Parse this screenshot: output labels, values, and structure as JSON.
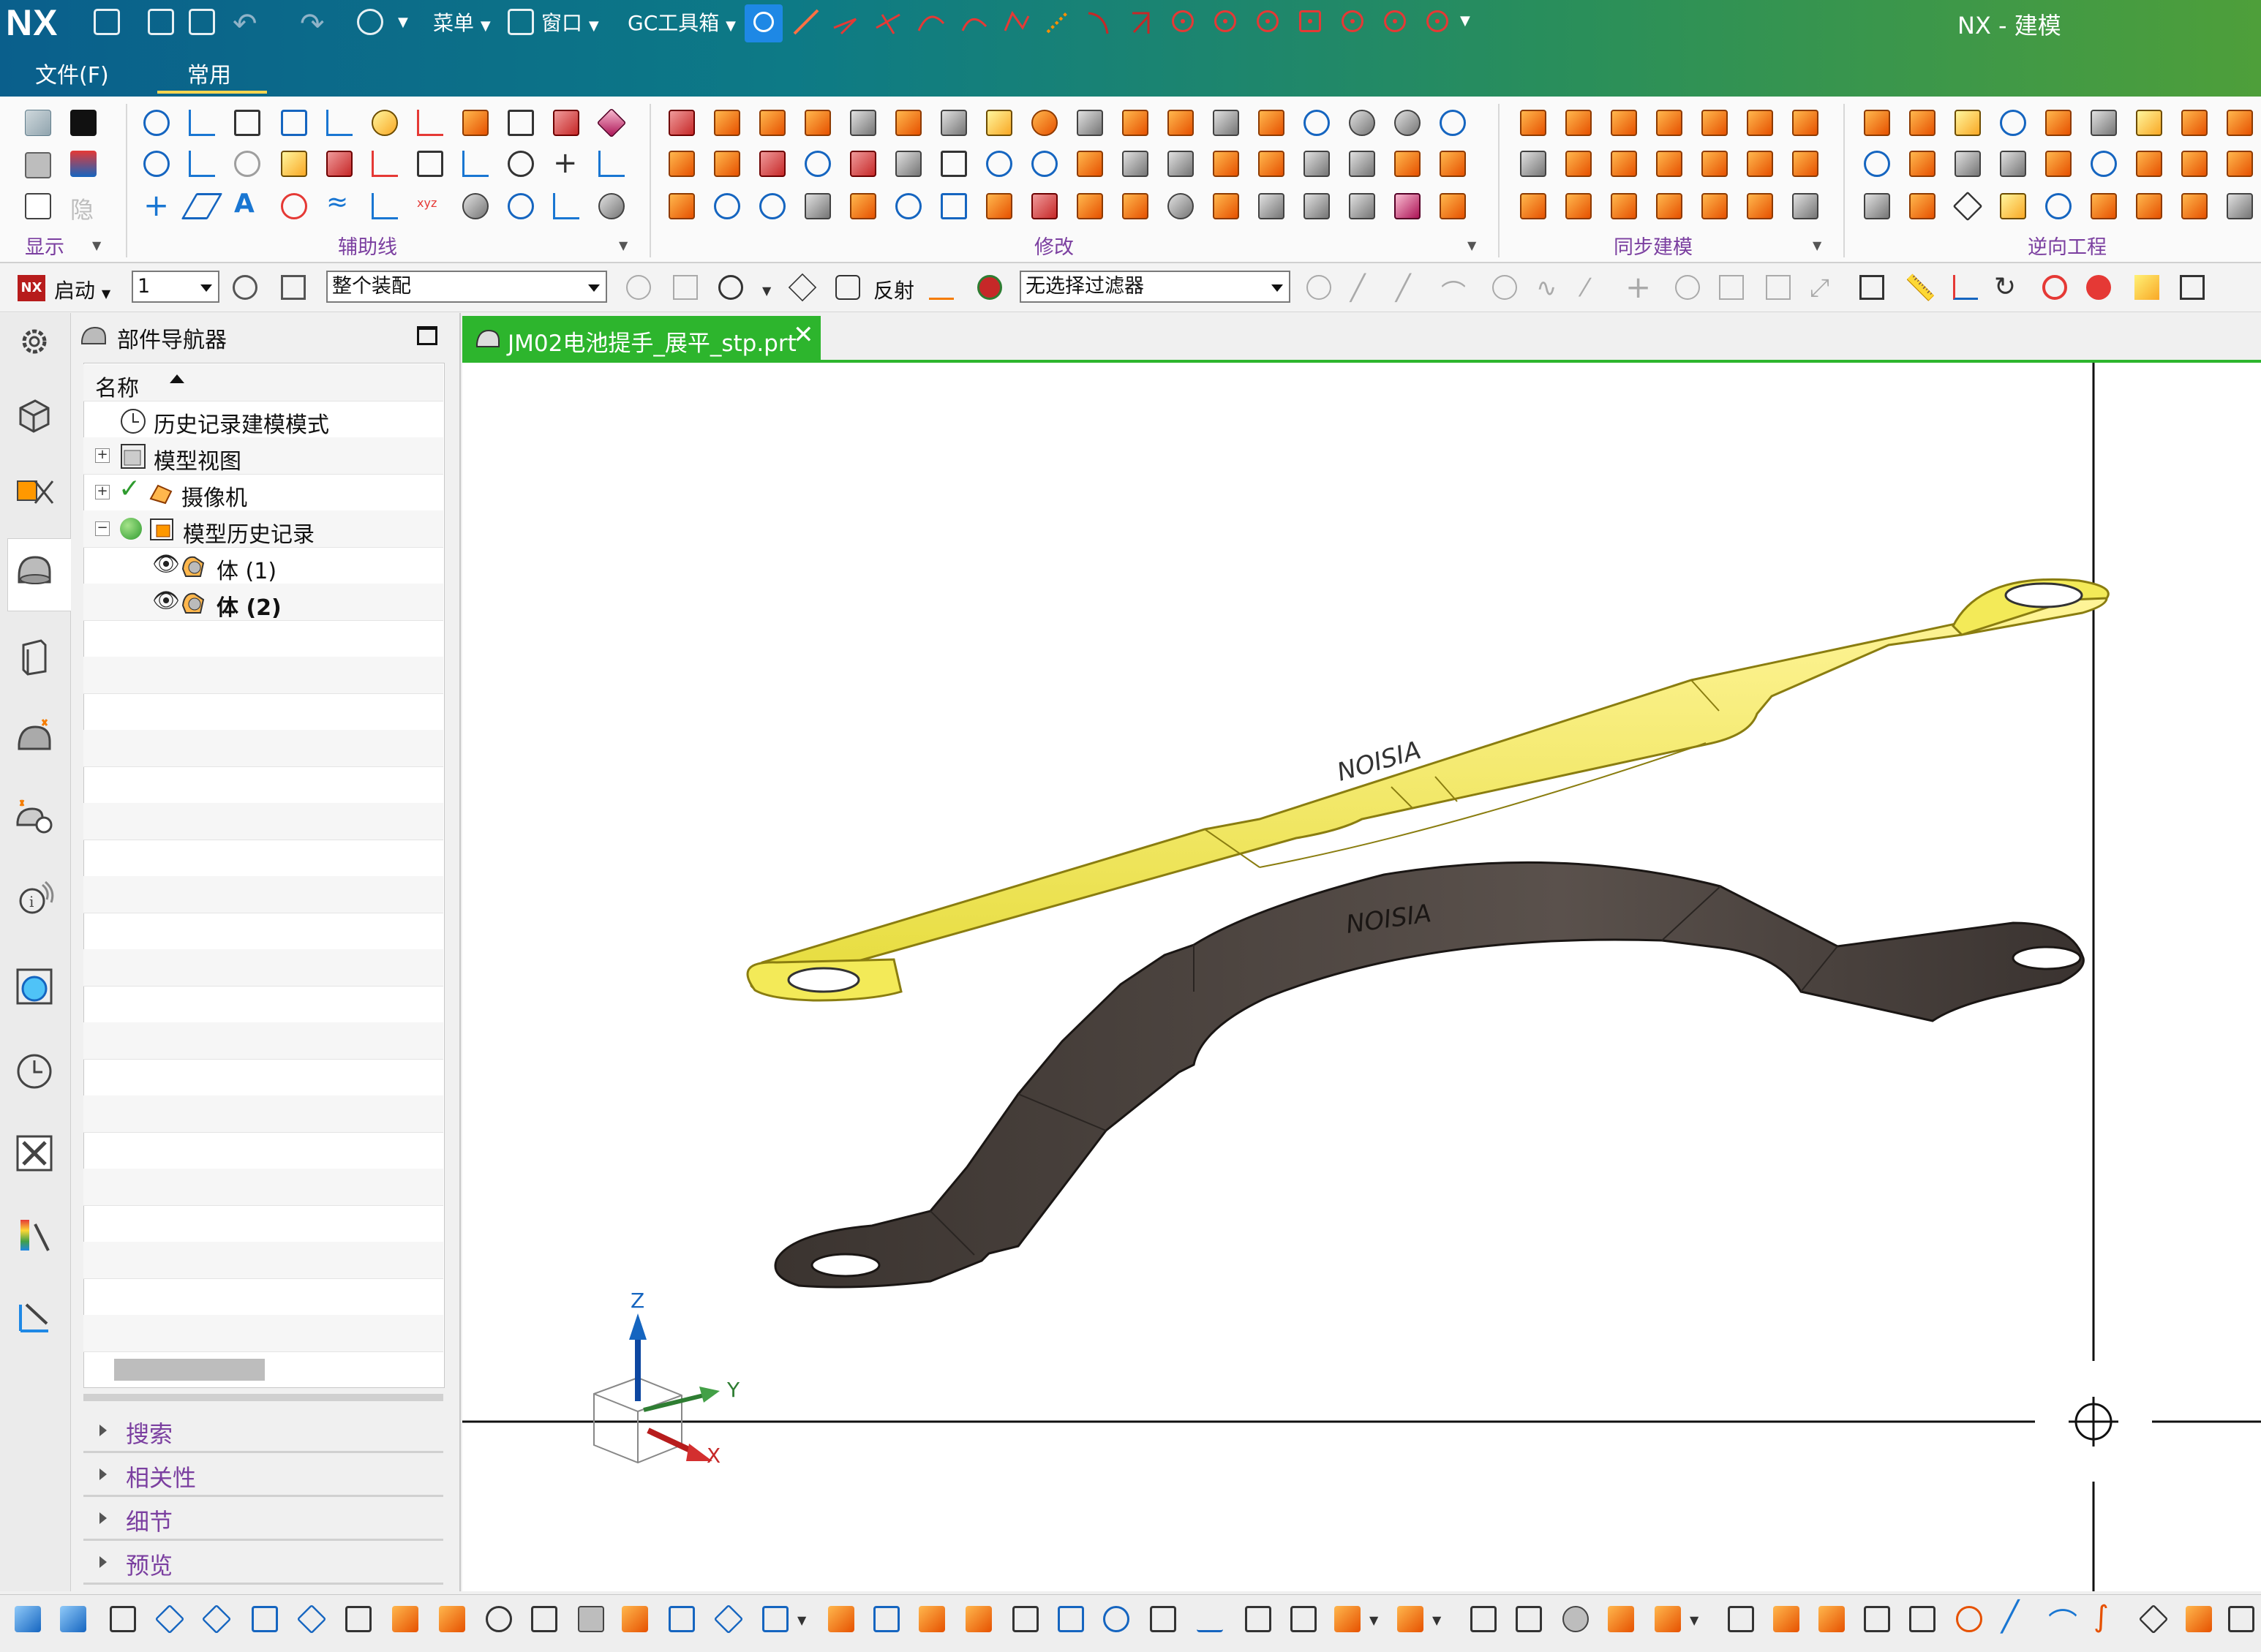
{
  "app": {
    "logo": "NX",
    "title": "NX - 建模"
  },
  "quickaccess": {
    "menu_label": "菜单",
    "window_label": "窗口",
    "gc_toolbox_label": "GC工具箱"
  },
  "menu_tabs": {
    "file": "文件(F)",
    "common": "常用"
  },
  "ribbon_groups": {
    "display": "显示",
    "aux_lines": "辅助线",
    "modify": "修改",
    "sync_modeling": "同步建模",
    "reverse_engineering": "逆向工程"
  },
  "toolbar2": {
    "start_label": "启动",
    "number_value": "1",
    "assembly_scope": "整个装配",
    "reflect_label": "反射",
    "selection_filter": "无选择过滤器"
  },
  "navigator": {
    "title": "部件导航器",
    "column_header": "名称",
    "tree": [
      {
        "label": "历史记录建模模式"
      },
      {
        "label": "模型视图"
      },
      {
        "label": "摄像机"
      },
      {
        "label": "模型历史记录"
      },
      {
        "label": "体 (1)"
      },
      {
        "label": "体 (2)"
      }
    ],
    "sections": [
      "搜索",
      "相关性",
      "细节",
      "预览"
    ]
  },
  "document_tab": {
    "label": "JM02电池提手_展平_stp.prt"
  },
  "triad": {
    "z": "Z",
    "y": "Y",
    "x": "X"
  },
  "model": {
    "emboss_text": "NOISIA",
    "top_body_color": "#f0ea60",
    "bottom_body_color": "#4a413c"
  },
  "colors": {
    "accent_purple": "#7b3fa0",
    "doc_tab_green": "#2db52d"
  }
}
